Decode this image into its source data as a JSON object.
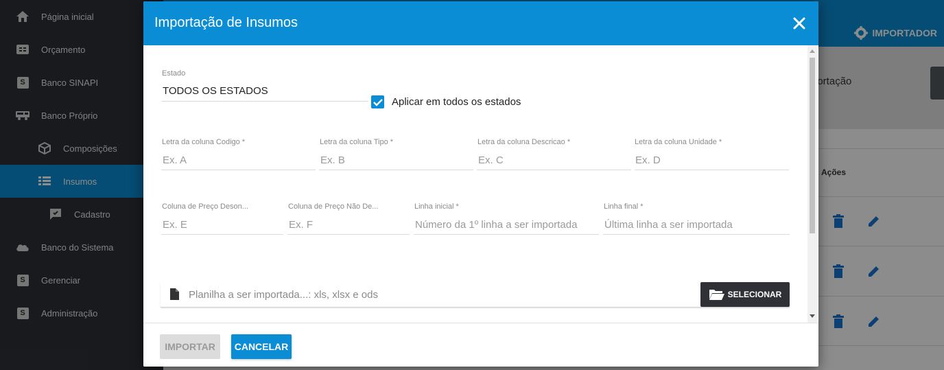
{
  "sidebar": {
    "items": [
      {
        "label": "Página inicial",
        "icon": "home-icon"
      },
      {
        "label": "Orçamento",
        "icon": "budget-icon"
      },
      {
        "label": "Banco SINAPI",
        "icon": "s-icon"
      },
      {
        "label": "Banco Próprio",
        "icon": "truck-icon"
      },
      {
        "label": "Composições",
        "icon": "cube-icon"
      },
      {
        "label": "Insumos",
        "icon": "list-icon"
      },
      {
        "label": "Cadastro",
        "icon": "add-comment-icon"
      },
      {
        "label": "Banco do Sistema",
        "icon": "cloud-icon"
      },
      {
        "label": "Gerenciar",
        "icon": "s-icon"
      },
      {
        "label": "Administração",
        "icon": "s-icon"
      }
    ],
    "box_letter": "S"
  },
  "background": {
    "importer_label": "IMPORTADOR",
    "partial_title": "portação",
    "actions_header": "Ações"
  },
  "modal": {
    "title": "Importação de Insumos",
    "estado": {
      "label": "Estado",
      "value": "TODOS OS ESTADOS"
    },
    "apply_all": {
      "label": "Aplicar em todos os estados",
      "checked": true
    },
    "row1": [
      {
        "label": "Letra da coluna Codigo *",
        "placeholder": "Ex. A"
      },
      {
        "label": "Letra da coluna Tipo *",
        "placeholder": "Ex. B"
      },
      {
        "label": "Letra da coluna Descricao *",
        "placeholder": "Ex. C"
      },
      {
        "label": "Letra da coluna Unidade *",
        "placeholder": "Ex. D"
      }
    ],
    "row2": [
      {
        "label": "Coluna de Preço Deson...",
        "placeholder": "Ex. E"
      },
      {
        "label": "Coluna de Preço Não De...",
        "placeholder": "Ex. F"
      },
      {
        "label": "Linha inicial *",
        "placeholder": "Número da 1º linha a ser importada"
      },
      {
        "label": "Linha final *",
        "placeholder": "Última linha a ser importada"
      }
    ],
    "file": {
      "placeholder": "Planilha a ser importada...: xls, xlsx e ods",
      "select_label": "SELECIONAR"
    },
    "footer": {
      "import_label": "IMPORTAR",
      "cancel_label": "CANCELAR"
    }
  },
  "colors": {
    "primary": "#0b8dd6",
    "sidebar": "#2f3136",
    "delete": "#1676d2"
  }
}
